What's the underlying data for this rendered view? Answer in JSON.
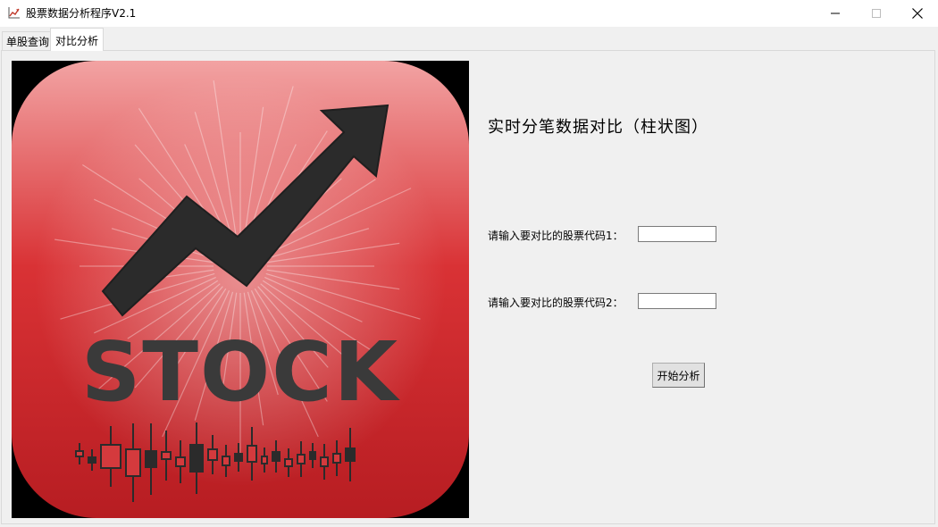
{
  "window": {
    "title": "股票数据分析程序V2.1",
    "icon": "chart-up-icon",
    "controls": [
      "minimize-icon",
      "maximize-icon",
      "close-icon"
    ]
  },
  "tabs": [
    {
      "label": "单股查询",
      "selected": false
    },
    {
      "label": "对比分析",
      "selected": true
    }
  ],
  "logo": {
    "text": "STOCK",
    "icon": "stock-logo",
    "colors": {
      "top": "#f2a3a3",
      "mid": "#d93235",
      "bottom": "#b71d22",
      "arrow": "#2b2b2b"
    }
  },
  "panel": {
    "heading": "实时分笔数据对比（柱状图）",
    "field1": {
      "label": "请输入要对比的股票代码1：",
      "value": "",
      "placeholder": ""
    },
    "field2": {
      "label": "请输入要对比的股票代码2：",
      "value": "",
      "placeholder": ""
    },
    "start_button": "开始分析"
  }
}
